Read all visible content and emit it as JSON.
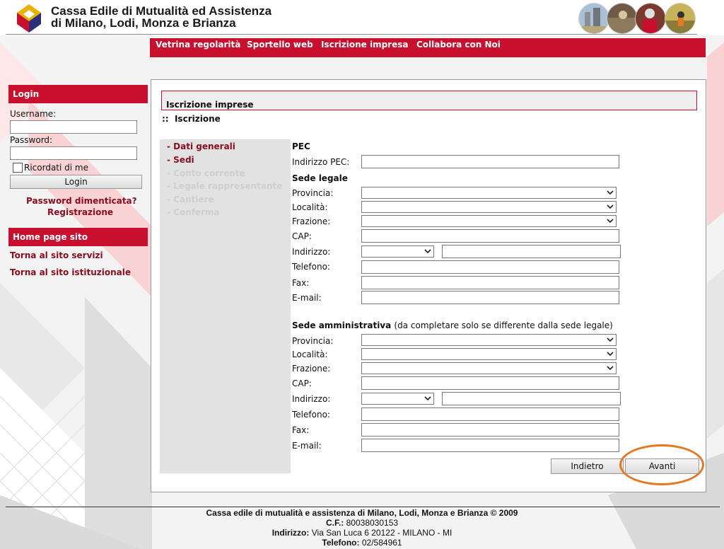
{
  "header": {
    "org_line1": "Cassa Edile di Mutualità ed Assistenza",
    "org_line2": "di Milano, Lodi, Monza e Brianza"
  },
  "topnav": [
    "Vetrina regolarità",
    "Sportello web",
    "Iscrizione impresa",
    "Collabora con Noi"
  ],
  "sidebar": {
    "login_title": "Login",
    "username_label": "Username:",
    "username_value": "",
    "password_label": "Password:",
    "password_value": "",
    "remember_label": "Ricordati di me",
    "remember_checked": false,
    "login_button": "Login",
    "forgot_link": "Password dimenticata?",
    "register_link": "Registrazione",
    "home_title": "Home page sito",
    "link_servizi": "Torna al sito servizi",
    "link_istituzionale": "Torna al sito istituzionale"
  },
  "main": {
    "title": "Iscrizione imprese",
    "breadcrumb_sep": "::",
    "breadcrumb": "Iscrizione",
    "steps": [
      {
        "label": "- Dati generali",
        "state": "active"
      },
      {
        "label": "- Sedi",
        "state": "active"
      },
      {
        "label": "- Conto corrente",
        "state": "inactive"
      },
      {
        "label": "- Legale rappresentante",
        "state": "inactive"
      },
      {
        "label": "- Cantiere",
        "state": "inactive"
      },
      {
        "label": "- Conferma",
        "state": "inactive"
      }
    ],
    "pec": {
      "title": "PEC",
      "address_label": "Indirizzo PEC:",
      "address_value": ""
    },
    "sede_legale": {
      "title": "Sede legale",
      "provincia_label": "Provincia:",
      "localita_label": "Località:",
      "frazione_label": "Frazione:",
      "cap_label": "CAP:",
      "indirizzo_label": "Indirizzo:",
      "telefono_label": "Telefono:",
      "fax_label": "Fax:",
      "email_label": "E-mail:"
    },
    "sede_amministrativa": {
      "title": "Sede amministrativa",
      "note": "(da completare solo se differente dalla sede legale)",
      "provincia_label": "Provincia:",
      "localita_label": "Località:",
      "frazione_label": "Frazione:",
      "cap_label": "CAP:",
      "indirizzo_label": "Indirizzo:",
      "telefono_label": "Telefono:",
      "fax_label": "Fax:",
      "email_label": "E-mail:"
    },
    "back_button": "Indietro",
    "next_button": "Avanti"
  },
  "footer": {
    "line1": "Cassa edile di mutualità e assistenza di Milano, Lodi, Monza e Brianza © 2009",
    "cf_label": "C.F.:",
    "cf_value": "80038030153",
    "address_label": "Indirizzo:",
    "address_value": "Via San Luca 6 20122 - MILANO - MI",
    "phone_label": "Telefono:",
    "phone_value": "02/584961"
  },
  "colors": {
    "brand_red": "#c8102e",
    "link_dark_red": "#8b0d1e",
    "highlight_orange": "#e87722"
  }
}
